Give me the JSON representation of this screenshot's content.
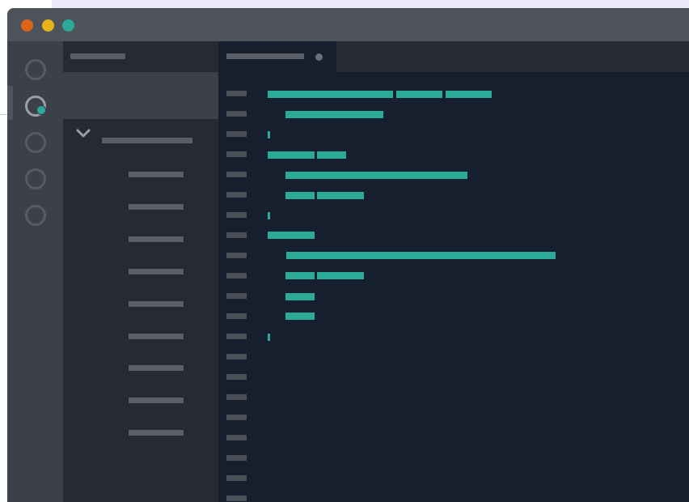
{
  "colors": {
    "page_background": "#e9e9f7",
    "titlebar": "#4d525b",
    "traffic_red": "#dd6417",
    "traffic_yellow": "#e8b41b",
    "traffic_green": "#2aaa97",
    "activity_bar": "#3c4049",
    "sidebar": "#262a33",
    "editor": "#161f2e",
    "code_token": "#2aaa97",
    "placeholder_bar": "#5a5e66"
  },
  "window": {
    "traffic_lights": [
      "close",
      "minimize",
      "maximize"
    ]
  },
  "activity_bar": {
    "items": [
      {
        "icon": "circle-icon",
        "active": false
      },
      {
        "icon": "circle-icon",
        "active": true,
        "badge": true
      },
      {
        "icon": "circle-icon",
        "active": false
      },
      {
        "icon": "circle-icon",
        "active": false
      },
      {
        "icon": "circle-icon",
        "active": false
      }
    ]
  },
  "sidebar": {
    "folder_expanded": true,
    "file_count": 9
  },
  "editor": {
    "tab_modified": true,
    "line_count": 21
  }
}
